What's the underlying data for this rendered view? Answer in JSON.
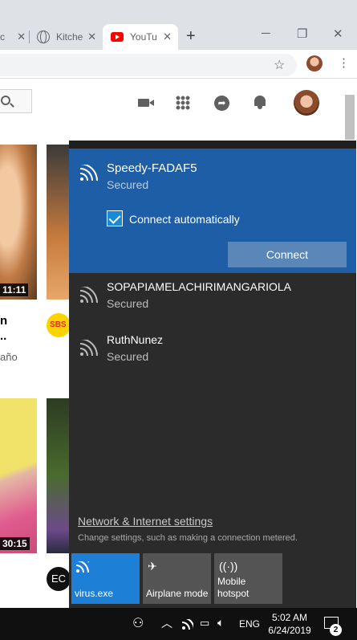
{
  "browser": {
    "tabs": [
      {
        "label": "c",
        "close": "✕"
      },
      {
        "label": "Kitche",
        "close": "✕"
      },
      {
        "label": "YouTu",
        "close": "✕"
      }
    ],
    "new_tab": "+",
    "window": {
      "minimize": "─",
      "maximize": "❐",
      "close": "✕"
    },
    "star": "☆",
    "menu": "⋮"
  },
  "youtube": {
    "videos": [
      {
        "duration": "11:11",
        "title_line1": "n",
        "title_line2": "..",
        "meta": "año",
        "channel_badge": "SBS"
      },
      {
        "duration": "30:15",
        "channel_badge": "EC"
      }
    ]
  },
  "network_flyout": {
    "selected": {
      "name": "Speedy-FADAF5",
      "status": "Secured",
      "connect_automatically": "Connect automatically",
      "connect_button": "Connect"
    },
    "networks": [
      {
        "name": "SOPAPIAMELACHIRIMANGARIOLA",
        "status": "Secured"
      },
      {
        "name": "RuthNunez",
        "status": "Secured"
      }
    ],
    "settings_link": "Network & Internet settings",
    "settings_desc": "Change settings, such as making a connection metered.",
    "quick_actions": [
      {
        "label": "virus.exe",
        "icon": "wifi-icon",
        "active": true
      },
      {
        "label": "Airplane mode",
        "icon": "airplane-icon",
        "active": false
      },
      {
        "label_line1": "Mobile",
        "label_line2": "hotspot",
        "icon": "hotspot-icon",
        "active": false
      }
    ]
  },
  "taskbar": {
    "language": "ENG",
    "time": "5:02 AM",
    "date": "6/24/2019",
    "notifications": "2"
  },
  "colors": {
    "accent": "#1d5ea6",
    "connect_button": "#5b87b8",
    "flyout_bg": "#2b2b2b",
    "taskbar_bg": "#101010"
  }
}
